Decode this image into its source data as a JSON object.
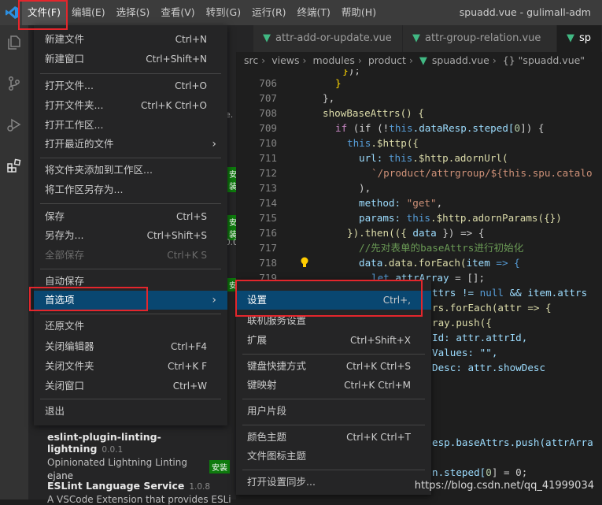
{
  "window": {
    "title": "spuadd.vue - gulimall-adm",
    "menubar": [
      "文件(F)",
      "编辑(E)",
      "选择(S)",
      "查看(V)",
      "转到(G)",
      "运行(R)",
      "终端(T)",
      "帮助(H)"
    ]
  },
  "tabs": [
    "attr-add-or-update.vue",
    "attr-group-relation.vue",
    "sp"
  ],
  "breadcrumb": [
    "src",
    "views",
    "modules",
    "product",
    "spuadd.vue",
    "{} \"spuadd.vue\""
  ],
  "file_menu": [
    {
      "label": "新建文件",
      "key": "Ctrl+N"
    },
    {
      "label": "新建窗口",
      "key": "Ctrl+Shift+N"
    },
    {
      "label": "打开文件...",
      "key": "Ctrl+O"
    },
    {
      "label": "打开文件夹...",
      "key": "Ctrl+K Ctrl+O"
    },
    {
      "label": "打开工作区...",
      "key": ""
    },
    {
      "label": "打开最近的文件",
      "key": ""
    },
    {
      "label": "将文件夹添加到工作区...",
      "key": ""
    },
    {
      "label": "将工作区另存为...",
      "key": ""
    },
    {
      "label": "保存",
      "key": "Ctrl+S"
    },
    {
      "label": "另存为...",
      "key": "Ctrl+Shift+S"
    },
    {
      "label": "全部保存",
      "key": "Ctrl+K S"
    },
    {
      "label": "自动保存",
      "key": ""
    },
    {
      "label": "首选项",
      "key": ""
    },
    {
      "label": "还原文件",
      "key": ""
    },
    {
      "label": "关闭编辑器",
      "key": "Ctrl+F4"
    },
    {
      "label": "关闭文件夹",
      "key": "Ctrl+K F"
    },
    {
      "label": "关闭窗口",
      "key": "Ctrl+W"
    },
    {
      "label": "退出",
      "key": ""
    }
  ],
  "prefs_menu": [
    {
      "label": "设置",
      "key": "Ctrl+,"
    },
    {
      "label": "联机服务设置",
      "key": ""
    },
    {
      "label": "扩展",
      "key": "Ctrl+Shift+X"
    },
    {
      "label": "键盘快捷方式",
      "key": "Ctrl+K Ctrl+S"
    },
    {
      "label": "键映射",
      "key": "Ctrl+K Ctrl+M"
    },
    {
      "label": "用户片段",
      "key": ""
    },
    {
      "label": "颜色主题",
      "key": "Ctrl+K Ctrl+T"
    },
    {
      "label": "文件图标主题",
      "key": ""
    },
    {
      "label": "打开设置同步...",
      "key": ""
    }
  ],
  "extensions": [
    {
      "name": "eslint-plugin-linting-lightning",
      "version": "0.0.1",
      "desc": "Opinionated Lightning Linting",
      "publisher": "ejane",
      "install": "安装"
    },
    {
      "name": "ESLint Language Service",
      "version": "1.0.8",
      "desc": "A VSCode Extension that provides ESLi",
      "publisher": "",
      "install": ""
    }
  ],
  "sidebar_fragments": [
    "e.",
    "安装",
    "安装",
    "0.0",
    "安"
  ],
  "line_numbers": [
    "706",
    "707",
    "708",
    "709",
    "710",
    "711",
    "712",
    "713",
    "714",
    "715",
    "716",
    "717",
    "718",
    "719"
  ],
  "code": {
    "l708": "showBaseAttrs() {",
    "l709a": "if (!",
    "l709b": "this",
    "l709c": ".dataResp.steped[",
    "l709d": "0",
    "l709e": "]) {",
    "l710a": "this",
    "l710b": ".$http({",
    "l711a": "url: ",
    "l711b": "this",
    "l711c": ".$http.adornUrl(",
    "l712": "`/product/attrgroup/${this.spu.catalo",
    "l714a": "method: ",
    "l714b": "\"get\"",
    "l715a": "params: ",
    "l715b": "this",
    "l715c": ".$http.adornParams({})",
    "l716a": "}).then(({ ",
    "l716b": "data",
    "l716c": " }) => {",
    "l717": "//先对表单的baseAttrs进行初始化",
    "l718a": "data",
    "l718b": ".data.forEach(",
    "l718c": "item",
    "l718d": " => {",
    "l719a": "let ",
    "l719b": "attrArray",
    "l719c": " = [];",
    "r1a": "ttrs != ",
    "r1b": "null",
    "r1c": " && item.attrs",
    "r2a": "rs.forEach(attr => {",
    "r3a": "ray.push({",
    "r4a": "Id: attr.attrId,",
    "r5a": "Values: \"\",",
    "r6a": "Desc: attr.showDesc",
    "r7a": "esp.baseAttrs.push(attrArra",
    "r8a": "n.steped[",
    "r8b": "0",
    "r8c": "] = 0;"
  },
  "watermark": "https://blog.csdn.net/qq_41999034"
}
